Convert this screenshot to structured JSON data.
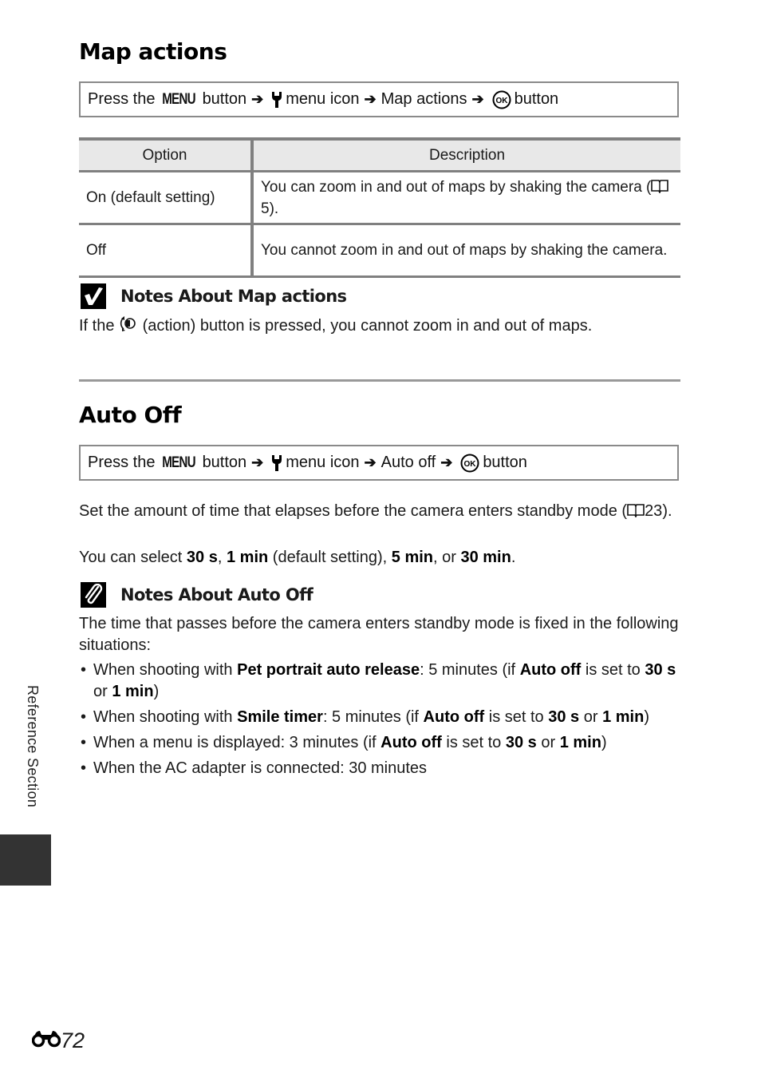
{
  "section1": {
    "title": "Map actions",
    "menu_path": {
      "press": "Press the",
      "menu_label": "MENU",
      "button_word": "button",
      "menu_icon_text": "menu icon",
      "item": "Map actions",
      "final_button": "button",
      "icons": [
        "menu-button-icon",
        "arrow-right-icon",
        "wrench-icon",
        "arrow-right-icon",
        "arrow-right-icon",
        "ok-button-icon"
      ]
    },
    "table": {
      "headers": [
        "Option",
        "Description"
      ],
      "rows": [
        {
          "option": "On (default setting)",
          "description_pre": "You can zoom in and out of maps by shaking the camera (",
          "ref": "5",
          "description_post": ")."
        },
        {
          "option": "Off",
          "description": "You cannot zoom in and out of maps by shaking the camera."
        }
      ]
    },
    "note": {
      "icon": "check-icon",
      "title": "Notes About Map actions",
      "text_pre": "If the",
      "icon_inline": "action-button-icon",
      "text_post": "(action) button is pressed, you cannot zoom in and out of maps."
    }
  },
  "section2": {
    "title": "Auto Off",
    "menu_path": {
      "press": "Press the",
      "menu_label": "MENU",
      "button_word": "button",
      "menu_icon_text": "menu icon",
      "item": "Auto off",
      "final_button": "button"
    },
    "para1_pre": "Set the amount of time that elapses before the camera enters standby mode (",
    "para1_ref": "23",
    "para1_post": ").",
    "para2": {
      "pre": "You can select ",
      "opt1": "30 s",
      "sep1": ", ",
      "opt2": "1 min",
      "mid": " (default setting), ",
      "opt3": "5 min",
      "sep2": ", or ",
      "opt4": "30 min",
      "end": "."
    },
    "note": {
      "icon": "paperclip-icon",
      "title": "Notes About Auto Off",
      "text": "The time that passes before the camera enters standby mode is fixed in the following situations:",
      "bullets": [
        {
          "pre": "When shooting with ",
          "b1": "Pet portrait auto release",
          "mid": ": 5 minutes (if ",
          "b2": "Auto off",
          "mid2": " is set to ",
          "b3": "30 s",
          "or": " or ",
          "b4": "1 min",
          "end": ")"
        },
        {
          "pre": "When shooting with ",
          "b1": "Smile timer",
          "mid": ": 5 minutes (if ",
          "b2": "Auto off",
          "mid2": " is set to ",
          "b3": "30 s",
          "or": " or ",
          "b4": "1 min",
          "end": ")"
        },
        {
          "pre": "When a menu is displayed: 3 minutes (if ",
          "b2": "Auto off",
          "mid2": " is set to ",
          "b3": "30 s",
          "or": " or ",
          "b4": "1 min",
          "end": ")"
        },
        {
          "pre": "When the AC adapter is connected: 30 minutes"
        }
      ]
    }
  },
  "sidebar": {
    "label": "Reference Section",
    "tab_color": "#333333"
  },
  "footer": {
    "page_icon": "binoculars-icon",
    "page_number": "72"
  }
}
